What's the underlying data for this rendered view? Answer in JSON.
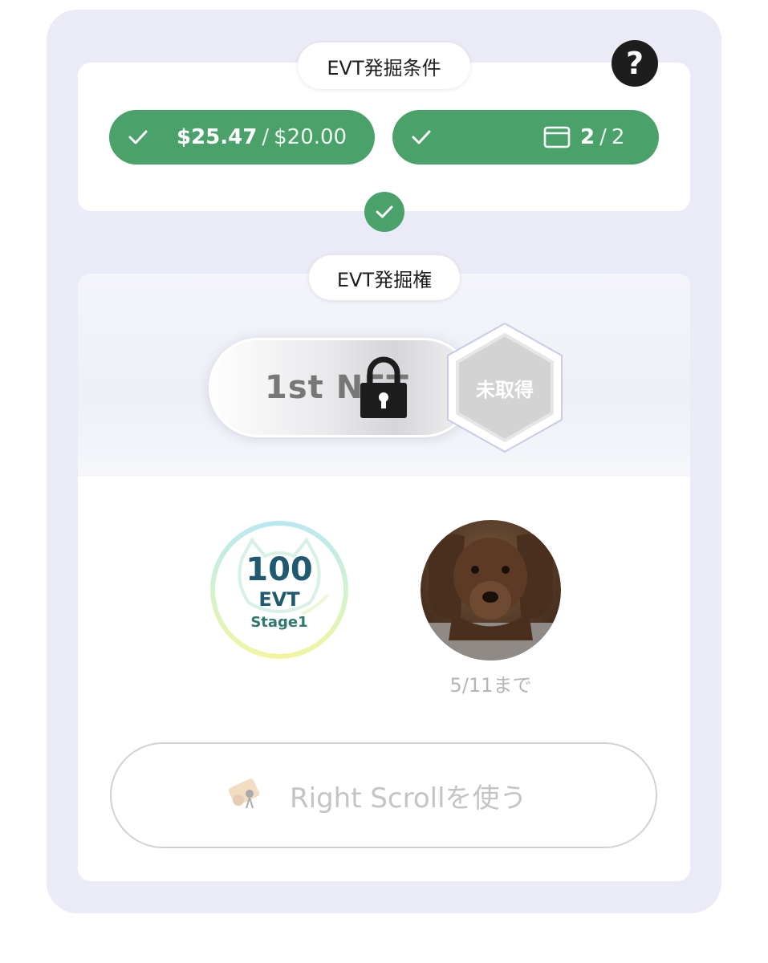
{
  "conditions": {
    "title": "EVT発掘条件",
    "help_label": "?",
    "usd": {
      "current": "$25.47",
      "separator": "/",
      "required": "$20.00"
    },
    "count": {
      "current": "2",
      "separator": "/",
      "required": "2"
    }
  },
  "rights": {
    "title": "EVT発掘権",
    "nft_label": "1st NFT",
    "status_badge": "未取得"
  },
  "rewards": {
    "evt_amount": "100",
    "evt_unit": "EVT",
    "evt_stage": "Stage1",
    "deadline": "5/11まで"
  },
  "action": {
    "label": "Right Scrollを使う"
  },
  "colors": {
    "success_green": "#4aa26a",
    "panel_bg": "#ebebf7",
    "dark": "#1d1d1d"
  },
  "icons": {
    "help": "question-icon",
    "check": "check-icon",
    "card": "card-icon",
    "lock": "lock-icon",
    "scroll": "scroll-icon"
  }
}
